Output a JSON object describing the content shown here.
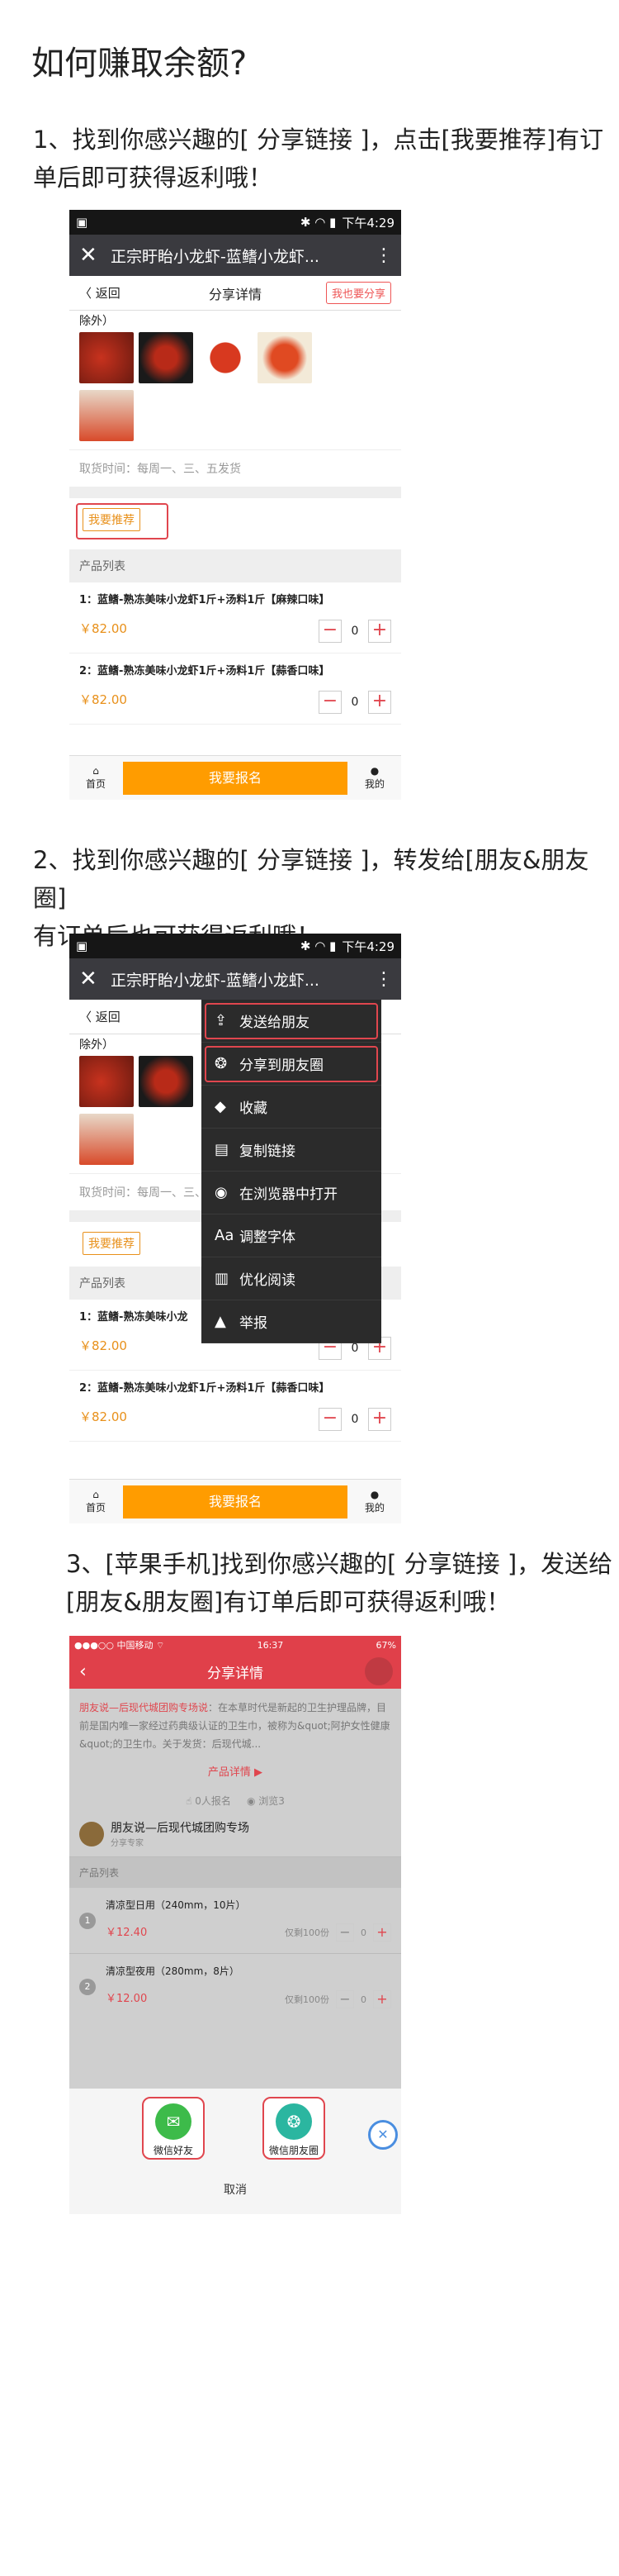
{
  "title": "如何赚取余额?",
  "steps": [
    {
      "line1": "1、找到你感兴趣的[ 分享链接 ]，点击[我要推荐]有订",
      "line2": "单后即可获得返利哦！"
    },
    {
      "line1": "2、找到你感兴趣的[ 分享链接 ]，转发给[朋友&朋友圈]",
      "line2": "有订单后也可获得返利哦！"
    },
    {
      "line1": "3、[苹果手机]找到你感兴趣的[ 分享链接 ]，发送给",
      "line2": "[朋友&朋友圈]有订单后即可获得返利哦！"
    }
  ],
  "android": {
    "time": "下午4:29",
    "page_title": "正宗盱眙小龙虾-蓝鳍小龙虾...",
    "back": "〈 返回",
    "nav_title": "分享详情",
    "share_btn": "我也要分享",
    "except_text": "除外）",
    "pickup": "取货时间：每周一、三、五发货",
    "recommend": "我要推荐",
    "product_list": "产品列表",
    "products": [
      {
        "name": "1：蓝鳍-熟冻美味小龙虾1斤+汤料1斤【麻辣口味】",
        "price": "￥82.00",
        "qty": "0"
      },
      {
        "name": "2：蓝鳍-熟冻美味小龙虾1斤+汤料1斤【蒜香口味】",
        "price": "￥82.00",
        "qty": "0"
      }
    ],
    "product1_short": "1：蓝鳍-熟冻美味小龙",
    "home": "首页",
    "signup": "我要报名",
    "mine": "我的",
    "menu": [
      {
        "icon": "⇪",
        "label": "发送给朋友"
      },
      {
        "icon": "❂",
        "label": "分享到朋友圈"
      },
      {
        "icon": "◆",
        "label": "收藏"
      },
      {
        "icon": "▤",
        "label": "复制链接"
      },
      {
        "icon": "◉",
        "label": "在浏览器中打开"
      },
      {
        "icon": "Aa",
        "label": "调整字体"
      },
      {
        "icon": "▥",
        "label": "优化阅读"
      },
      {
        "icon": "▲",
        "label": "举报"
      }
    ]
  },
  "ios": {
    "carrier": "●●●○○ 中国移动 ⌔",
    "time": "16:37",
    "battery": "67%",
    "nav_title": "分享详情",
    "intro_highlight": "朋友说—后现代城团购专场说",
    "intro_rest": "：在本草时代是新起的卫生护理品牌，目前是国内唯一家经过药典级认证的卫生巾，被称为&quot;阿护女性健康&quot;的卫生巾。关于发货：后现代城...",
    "detail": "产品详情 ▶",
    "signed": "0人报名",
    "views": "浏览3",
    "shop_name": "朋友说—后现代城团购专场",
    "shop_sub": "分享专家",
    "product_list": "产品列表",
    "products": [
      {
        "idx": "1",
        "name": "清凉型日用（240mm，10片）",
        "price": "￥12.40",
        "stock": "仅剩100份",
        "qty": "0"
      },
      {
        "idx": "2",
        "name": "清凉型夜用（280mm，8片）",
        "price": "￥12.00",
        "stock": "仅剩100份",
        "qty": "0"
      }
    ],
    "wechat_friend": "微信好友",
    "wechat_moments": "微信朋友圈",
    "cancel": "取消"
  },
  "colors": {
    "accent_red": "#e0464e",
    "orange": "#ff9c00",
    "ios_red": "#e0404a"
  }
}
